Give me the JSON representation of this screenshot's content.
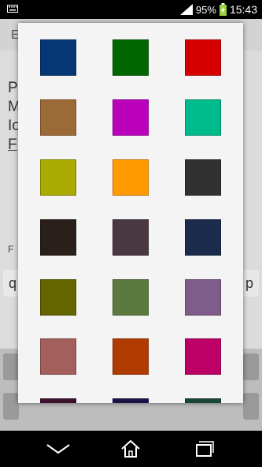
{
  "status": {
    "battery": "95%",
    "time": "15:43"
  },
  "background": {
    "title": "E",
    "lines": [
      "P",
      "M",
      "Io",
      "F"
    ],
    "small_label": "F",
    "key_q": "q",
    "key_p": "p"
  },
  "palette": {
    "colors": [
      "#063775",
      "#006600",
      "#d60000",
      "#9c6a36",
      "#bb00bb",
      "#00bb8c",
      "#aaaa00",
      "#ff9a00",
      "#303030",
      "#2a1f1b",
      "#493742",
      "#1b2b4b",
      "#656500",
      "#5b7a3d",
      "#7f5c8a",
      "#a35f5c",
      "#b03b00",
      "#bd0066",
      "#3b112e",
      "#1c1246",
      "#1a4635"
    ]
  },
  "nav": {
    "back_icon": "back-icon",
    "home_icon": "home-icon",
    "recents_icon": "recents-icon"
  }
}
